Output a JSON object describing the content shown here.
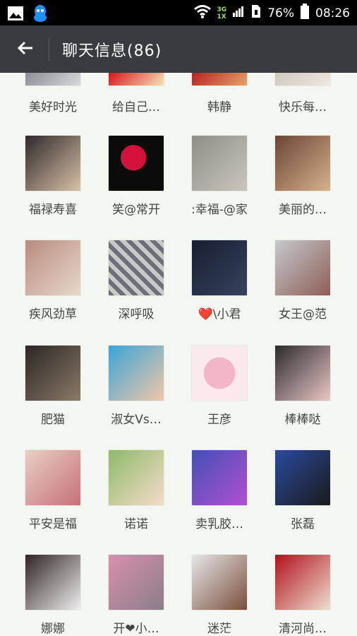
{
  "status": {
    "net_top": "3G",
    "net_bottom": "1X",
    "battery": "76%",
    "time": "08:26"
  },
  "header": {
    "title": "聊天信息(86)"
  },
  "contacts": [
    {
      "name": "美好时光",
      "colors": [
        "#8a8f94",
        "#d8d9da"
      ]
    },
    {
      "name": "给自己…",
      "colors": [
        "#d21818",
        "#f8e3b8"
      ]
    },
    {
      "name": "韩静",
      "colors": [
        "#b5241f",
        "#e6a36b"
      ]
    },
    {
      "name": "快乐每…",
      "colors": [
        "#cfc8c0",
        "#efe8de"
      ]
    },
    {
      "name": "福禄寿喜",
      "colors": [
        "#2d2a2a",
        "#d9c0a6"
      ]
    },
    {
      "name": "笑@常开",
      "colors": [
        "#0b0b0b",
        "#d3123b"
      ]
    },
    {
      "name": ":幸福-@家",
      "colors": [
        "#8e8e86",
        "#c8c6bd"
      ]
    },
    {
      "name": "美丽的…",
      "colors": [
        "#6a4535",
        "#d6b18c"
      ]
    },
    {
      "name": "疾风劲草",
      "colors": [
        "#b98b7f",
        "#e7d8cc"
      ]
    },
    {
      "name": "深呼吸",
      "colors": [
        "#6c6e78",
        "#c9c9c6"
      ]
    },
    {
      "name": "❤️\\小君",
      "colors": [
        "#161e33",
        "#36425d"
      ]
    },
    {
      "name": "女王@范",
      "colors": [
        "#c6c9cd",
        "#8d5e55"
      ]
    },
    {
      "name": "肥猫",
      "colors": [
        "#2b2724",
        "#8b7a68"
      ]
    },
    {
      "name": "淑女Vs…",
      "colors": [
        "#3aa4d6",
        "#f1c7a8"
      ]
    },
    {
      "name": "王彦",
      "colors": [
        "#f3b6c6",
        "#fbe9ee"
      ]
    },
    {
      "name": "棒棒哒",
      "colors": [
        "#2b2b2b",
        "#ebc6c6"
      ]
    },
    {
      "name": "平安是福",
      "colors": [
        "#e9cfc4",
        "#c7707a"
      ]
    },
    {
      "name": "诺诺",
      "colors": [
        "#8fba6a",
        "#f4dbc8"
      ]
    },
    {
      "name": "卖乳胶…",
      "colors": [
        "#4450b5",
        "#b04fd1"
      ]
    },
    {
      "name": "张磊",
      "colors": [
        "#2b4a9e",
        "#1a1a1a"
      ]
    },
    {
      "name": "娜娜",
      "colors": [
        "#2f2424",
        "#efefef"
      ]
    },
    {
      "name": "开❤小…",
      "colors": [
        "#d98fae",
        "#8a7f86"
      ]
    },
    {
      "name": "迷茫",
      "colors": [
        "#e7e7e7",
        "#7a4f3c"
      ]
    },
    {
      "name": "清河尚…",
      "colors": [
        "#b1101b",
        "#eedfcf"
      ]
    }
  ]
}
